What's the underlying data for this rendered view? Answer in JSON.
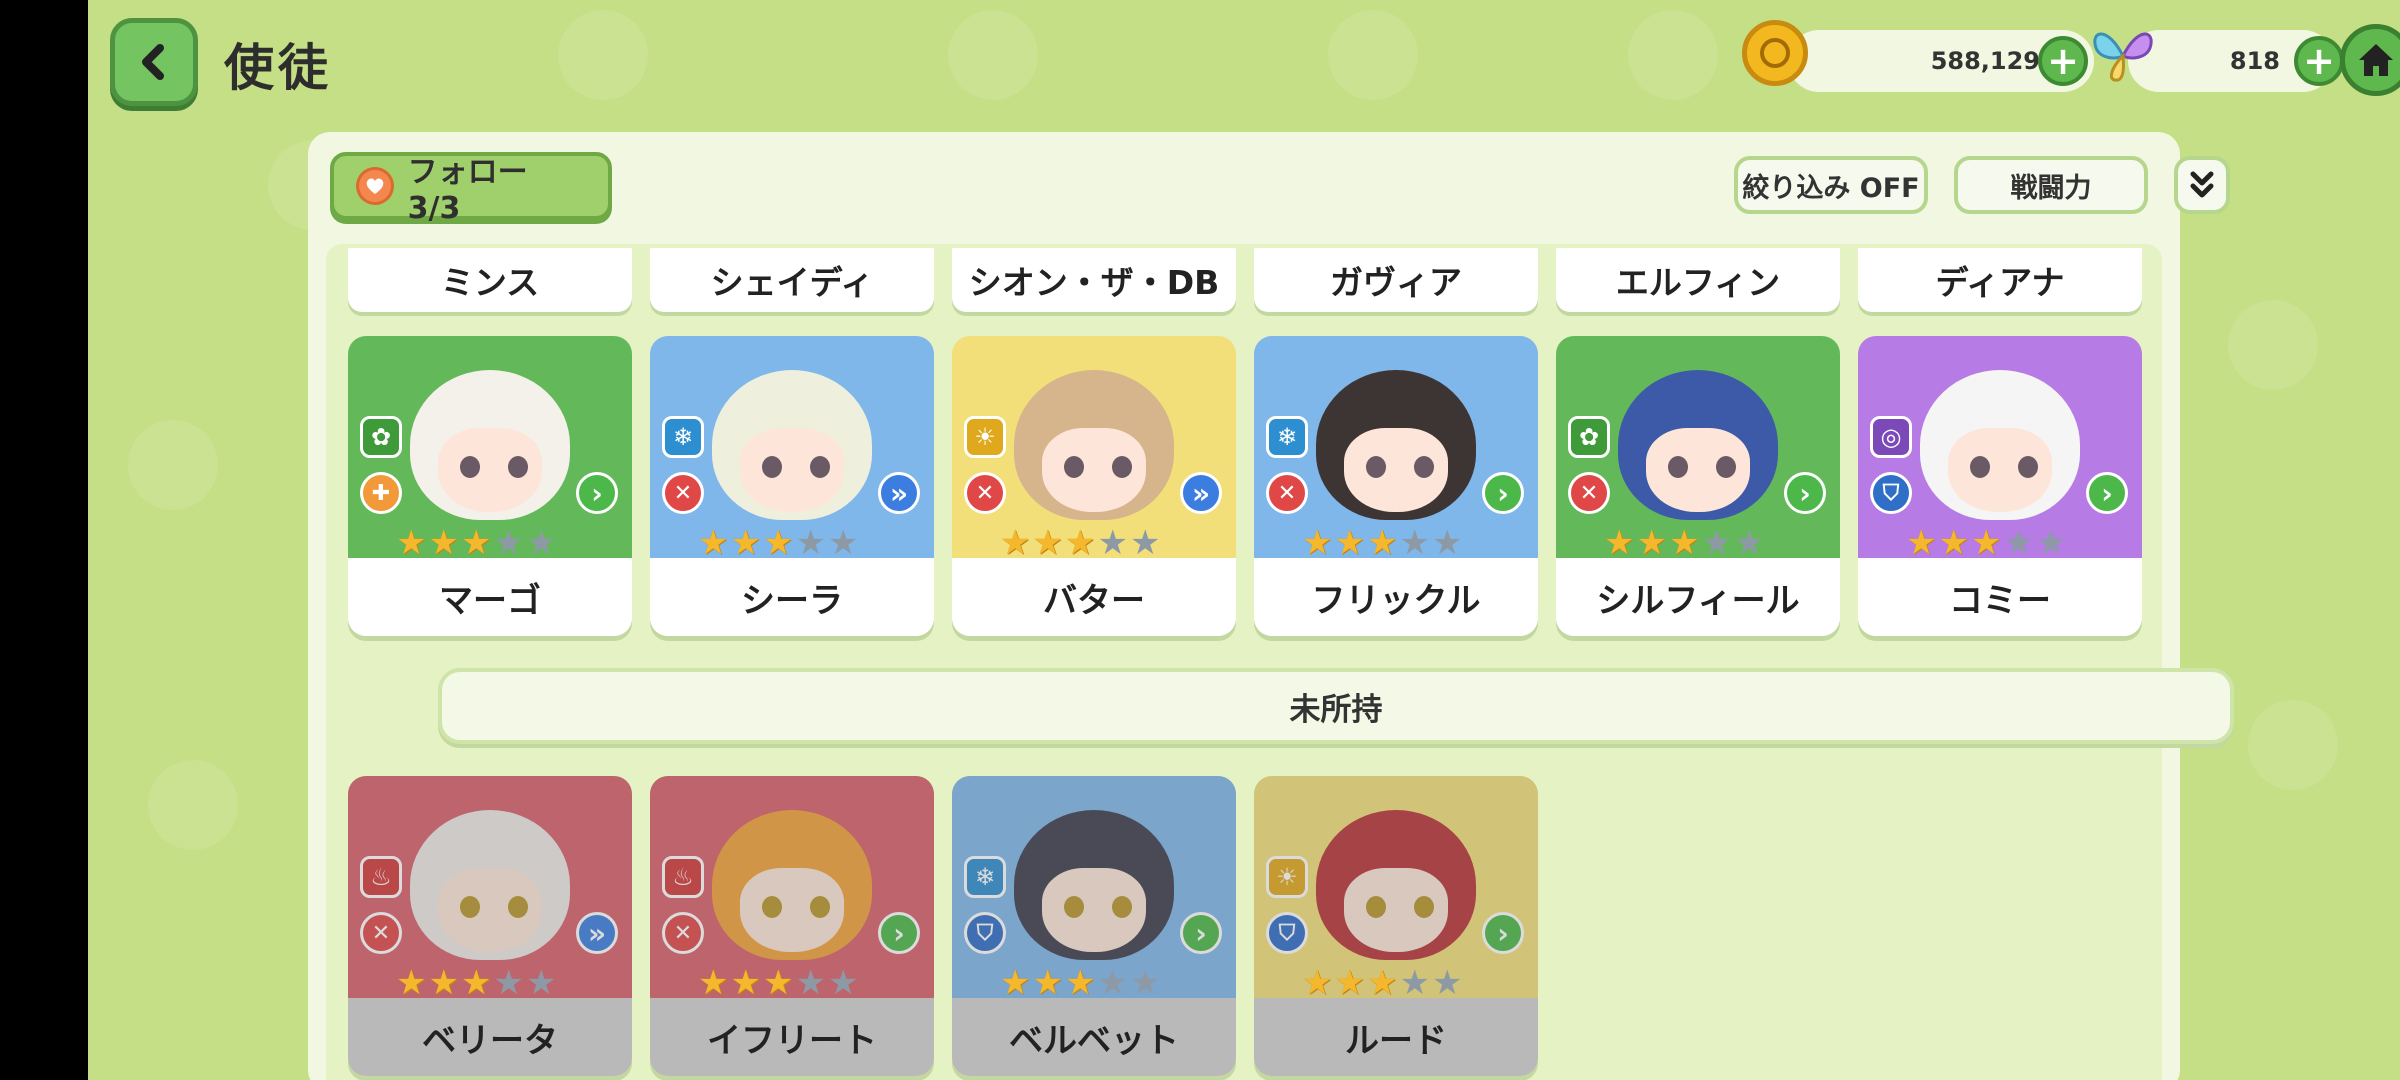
{
  "header": {
    "title": "使徒",
    "gold": "588,129",
    "gems": "818"
  },
  "toolbar": {
    "follow_label": "フォロー　3/3",
    "filter_label": "絞り込み OFF",
    "sort_label": "戦闘力"
  },
  "partial_row": {
    "names": [
      "ミンス",
      "シェイディ",
      "シオン・ザ・DB",
      "ガヴィア",
      "エルフィン",
      "ディアナ"
    ]
  },
  "owned": [
    {
      "name": "マーゴ",
      "stars": 3,
      "element": "nature",
      "role": "healer",
      "attack": "melee"
    },
    {
      "name": "シーラ",
      "stars": 3,
      "element": "water",
      "role": "attacker",
      "attack": "ranged"
    },
    {
      "name": "バター",
      "stars": 3,
      "element": "light",
      "role": "attacker",
      "attack": "ranged"
    },
    {
      "name": "フリックル",
      "stars": 3,
      "element": "water",
      "role": "attacker",
      "attack": "melee"
    },
    {
      "name": "シルフィール",
      "stars": 3,
      "element": "nature",
      "role": "attacker",
      "attack": "melee"
    },
    {
      "name": "コミー",
      "stars": 3,
      "element": "void",
      "role": "tank",
      "attack": "melee"
    }
  ],
  "section": {
    "unowned_label": "未所持"
  },
  "unowned": [
    {
      "name": "ベリータ",
      "stars": 3,
      "element": "fire",
      "role": "attacker",
      "attack": "ranged"
    },
    {
      "name": "イフリート",
      "stars": 3,
      "element": "fire",
      "role": "attacker",
      "attack": "melee"
    },
    {
      "name": "ベルベット",
      "stars": 3,
      "element": "water",
      "role": "tank",
      "attack": "melee"
    },
    {
      "name": "ルード",
      "stars": 3,
      "element": "light",
      "role": "tank",
      "attack": "melee"
    }
  ],
  "colors": {
    "background": "#c4df86",
    "accent_green": "#5fb84e",
    "fav_flower": "#e9586a",
    "star_on": "#f5b72c",
    "star_off": "#8d9aa6"
  }
}
